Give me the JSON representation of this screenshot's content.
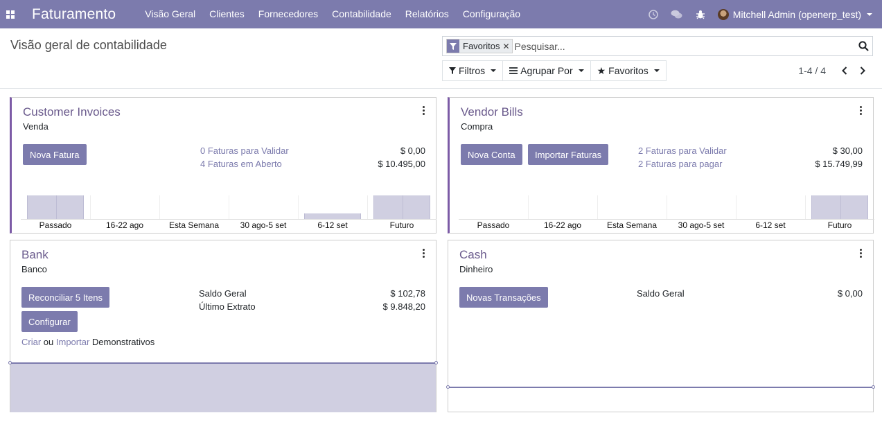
{
  "navbar": {
    "brand": "Faturamento",
    "menu": [
      {
        "label": "Visão Geral"
      },
      {
        "label": "Clientes"
      },
      {
        "label": "Fornecedores"
      },
      {
        "label": "Contabilidade"
      },
      {
        "label": "Relatórios"
      },
      {
        "label": "Configuração"
      }
    ],
    "user": "Mitchell Admin (openerp_test)"
  },
  "control_panel": {
    "title": "Visão geral de contabilidade",
    "facet": "Favoritos",
    "search_placeholder": "Pesquisar...",
    "filters_label": "Filtros",
    "group_by_label": "Agrupar Por",
    "favorites_label": "Favoritos",
    "pager": "1-4 / 4"
  },
  "cards": {
    "sales": {
      "title": "Customer Invoices",
      "subtitle": "Venda",
      "button": "Nova Fatura",
      "stats": [
        {
          "label": "0 Faturas para Validar",
          "value": "$ 0,00"
        },
        {
          "label": "4 Faturas em Aberto",
          "value": "$ 10.495,00"
        }
      ]
    },
    "purchase": {
      "title": "Vendor Bills",
      "subtitle": "Compra",
      "button1": "Nova Conta",
      "button2": "Importar Faturas",
      "stats": [
        {
          "label": "2 Faturas para Validar",
          "value": "$ 30,00"
        },
        {
          "label": "2 Faturas para pagar",
          "value": "$ 15.749,99"
        }
      ]
    },
    "bank": {
      "title": "Bank",
      "subtitle": "Banco",
      "button1": "Reconciliar 5 Itens",
      "button2": "Configurar",
      "stats": [
        {
          "label": "Saldo Geral",
          "value": "$ 102,78"
        },
        {
          "label": "Último Extrato",
          "value": "$ 9.848,20"
        }
      ],
      "note_create": "Criar",
      "note_or": "ou",
      "note_import": "Importar",
      "note_rest": "Demonstrativos"
    },
    "cash": {
      "title": "Cash",
      "subtitle": "Dinheiro",
      "button": "Novas Transações",
      "stats": [
        {
          "label": "Saldo Geral",
          "value": "$ 0,00"
        }
      ]
    }
  },
  "colors": {
    "brand": "#7c7bad",
    "title": "#6a5a8c",
    "bar": "#d0cfe1"
  },
  "chart_data": [
    {
      "type": "bar",
      "categories": [
        "Passado",
        "16-22 ago",
        "Esta Semana",
        "30 ago-5 set",
        "6-12 set",
        "Futuro"
      ],
      "values": [
        1.0,
        0,
        0,
        0,
        0.25,
        1.0
      ]
    },
    {
      "type": "bar",
      "categories": [
        "Passado",
        "16-22 ago",
        "Esta Semana",
        "30 ago-5 set",
        "6-12 set",
        "Futuro"
      ],
      "values": [
        0,
        0,
        0,
        0,
        0,
        1.0
      ]
    }
  ]
}
